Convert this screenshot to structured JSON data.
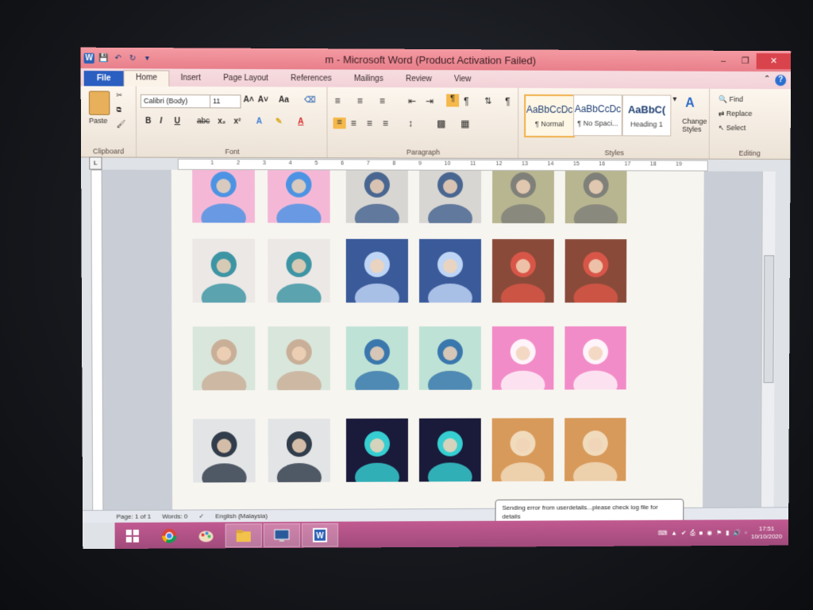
{
  "window": {
    "title": "m - Microsoft Word (Product Activation Failed)",
    "minimize": "–",
    "maximize": "❐",
    "close": "✕"
  },
  "tabs": [
    "File",
    "Home",
    "Insert",
    "Page Layout",
    "References",
    "Mailings",
    "Review",
    "View"
  ],
  "active_tab": "Home",
  "ribbon": {
    "clipboard": {
      "label": "Clipboard",
      "paste": "Paste"
    },
    "font": {
      "label": "Font",
      "family": "Calibri (Body)",
      "size": "11",
      "bold": "B",
      "italic": "I",
      "underline": "U",
      "strike": "abc",
      "subscript": "x₂",
      "superscript": "x²",
      "grow": "A˄",
      "shrink": "A˅",
      "case": "Aa"
    },
    "paragraph": {
      "label": "Paragraph"
    },
    "styles": {
      "label": "Styles",
      "items": [
        {
          "sample": "AaBbCcDc",
          "name": "¶ Normal"
        },
        {
          "sample": "AaBbCcDc",
          "name": "¶ No Spaci..."
        },
        {
          "sample": "AaBbC(",
          "name": "Heading 1"
        }
      ],
      "change": "Change Styles"
    },
    "editing": {
      "label": "Editing",
      "find": "Find",
      "replace": "Replace",
      "select": "Select"
    }
  },
  "ruler": [
    "1",
    "2",
    "3",
    "4",
    "5",
    "6",
    "7",
    "8",
    "9",
    "10",
    "11",
    "12",
    "13",
    "14",
    "15",
    "16",
    "17",
    "18",
    "19"
  ],
  "status": {
    "page": "Page: 1 of 1",
    "words": "Words: 0",
    "language": "English (Malaysia)"
  },
  "toast": {
    "text": "Sending error from userdetails...please check log file for details"
  },
  "clock": {
    "time": "17:51",
    "date": "10/10/2020"
  },
  "photos": [
    {
      "name": "doraemon",
      "color": "#f4b8d6",
      "accent": "#3b8fe6"
    },
    {
      "name": "doraemon",
      "color": "#f4b8d6",
      "accent": "#3b8fe6"
    },
    {
      "name": "girl-blue-hijab",
      "color": "#d8d6d2",
      "accent": "#3a5a8a"
    },
    {
      "name": "girl-blue-hijab",
      "color": "#d8d6d2",
      "accent": "#3a5a8a"
    },
    {
      "name": "gray-animal",
      "color": "#b8b690",
      "accent": "#7a7a78"
    },
    {
      "name": "gray-animal",
      "color": "#b8b690",
      "accent": "#7a7a78"
    },
    {
      "name": "girl-teal-hijab",
      "color": "#ece8e6",
      "accent": "#2a8c9c"
    },
    {
      "name": "girl-teal-hijab",
      "color": "#ece8e6",
      "accent": "#2a8c9c"
    },
    {
      "name": "anime-art",
      "color": "#3a5a9a",
      "accent": "#cde2ff"
    },
    {
      "name": "anime-art",
      "color": "#3a5a9a",
      "accent": "#cde2ff"
    },
    {
      "name": "red-hair-boy",
      "color": "#8a4a3a",
      "accent": "#e0584a"
    },
    {
      "name": "red-hair-boy",
      "color": "#8a4a3a",
      "accent": "#e0584a"
    },
    {
      "name": "woman-hijab",
      "color": "#d8e6dc",
      "accent": "#c8a890"
    },
    {
      "name": "woman-hijab",
      "color": "#d8e6dc",
      "accent": "#c8a890"
    },
    {
      "name": "girl-blue-hijab-2",
      "color": "#bfe2d6",
      "accent": "#2a6ca8"
    },
    {
      "name": "girl-blue-hijab-2",
      "color": "#bfe2d6",
      "accent": "#2a6ca8"
    },
    {
      "name": "pink-bunny",
      "color": "#f28cc8",
      "accent": "#ffffff"
    },
    {
      "name": "pink-bunny",
      "color": "#f28cc8",
      "accent": "#ffffff"
    },
    {
      "name": "boy",
      "color": "#e2e4e6",
      "accent": "#1e2a3a"
    },
    {
      "name": "boy",
      "color": "#e2e4e6",
      "accent": "#1e2a3a"
    },
    {
      "name": "neon-bear",
      "color": "#1a1a3a",
      "accent": "#3ae2e2"
    },
    {
      "name": "neon-bear",
      "color": "#1a1a3a",
      "accent": "#3ae2e2"
    },
    {
      "name": "kitten-hat",
      "color": "#d89a5a",
      "accent": "#f4e2c8"
    },
    {
      "name": "kitten-hat",
      "color": "#d89a5a",
      "accent": "#f4e2c8"
    }
  ]
}
